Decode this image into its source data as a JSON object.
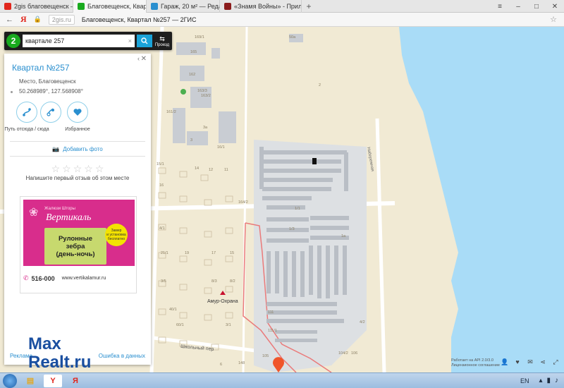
{
  "browser": {
    "tabs": [
      {
        "label": "2gis благовещенск — Янд",
        "favicon": "yandex-icon",
        "color": "#e1261c",
        "active": false
      },
      {
        "label": "Благовещенск, Квартал",
        "favicon": "2gis-icon",
        "color": "#19aa1e",
        "active": true
      },
      {
        "label": "Гараж, 20 м² — Редактир",
        "favicon": "maxrealt-icon",
        "color": "#2a8fcf",
        "active": false
      },
      {
        "label": "«Знамя Войны» - Прилож",
        "favicon": "game-icon",
        "color": "#8b1c1c",
        "active": false
      }
    ],
    "new_tab": "+",
    "site_badge": "2gis.ru",
    "page_title": "Благовещенск, Квартал №257 — 2ГИС",
    "yandex_logo": "Я"
  },
  "search": {
    "logo": "2",
    "query": "квартале 257",
    "clear": "×",
    "route_label": "Проезд"
  },
  "panel": {
    "title": "Квартал №257",
    "place": "Место, Благовещенск",
    "coords": "50.268989°, 127.568908°",
    "actions": [
      {
        "label": "Путь отсюда / сюда",
        "icon": "route-icon"
      },
      {
        "label": "Поделиться",
        "icon": "share-icon"
      },
      {
        "label": "Избранное",
        "icon": "heart-icon"
      }
    ],
    "add_photo": "Добавить фото",
    "review_prompt": "Напишите первый отзыв об этом месте",
    "footer_left": "Реклама",
    "footer_right": "Ошибка в данных"
  },
  "ad": {
    "small_text": "Жалюзи Шторы",
    "brand": "Вертикаль",
    "product_lines": [
      "Рулонные",
      "зебра",
      "(день-ночь)"
    ],
    "badge_lines": [
      "Замер",
      "и установка",
      "бесплатно"
    ],
    "phone": "516-000",
    "site": "www.vertikalamur.ru"
  },
  "map": {
    "labels": {
      "street_naberezhnaya": "Набережная",
      "street_shkolny": "Школьный пер",
      "poi_amur_okhrana": "Амур-Охрана"
    },
    "house_numbers": [
      "169/1",
      "165",
      "162",
      "163/3",
      "163/2",
      "161/2",
      "3а",
      "3",
      "50а",
      "2",
      "16/1",
      "15/1",
      "16",
      "14",
      "12",
      "11",
      "164/2",
      "1/1",
      "1/3",
      "1а",
      "4/1",
      "21/1",
      "19",
      "17",
      "15",
      "3/5",
      "8/3",
      "8/2",
      "111",
      "111/1",
      "40/1",
      "60/1",
      "3/1",
      "4/2",
      "106",
      "104/2",
      "148",
      "105",
      "6"
    ],
    "attribution_lines": [
      "Работает на API 2.0/3.0",
      "Лицензионное соглашение"
    ],
    "tools": [
      "person-icon",
      "heart-icon",
      "chat-icon",
      "share-icon",
      "fullscreen-icon"
    ]
  },
  "watermark": {
    "line1": "Max",
    "line2": "Realt.ru"
  },
  "taskbar": {
    "apps": [
      {
        "name": "explorer",
        "glyph": "▤",
        "color": "#e0a92a"
      },
      {
        "name": "yandex-browser",
        "glyph": "Y",
        "color": "#e1261c"
      },
      {
        "name": "yandex-app",
        "glyph": "Я",
        "color": "#e1261c"
      }
    ],
    "lang": "EN"
  },
  "colors": {
    "land": "#f1ead4",
    "water": "#a9dcf7",
    "blocks": "#c9cdd3",
    "garage_area": "#dde0e3",
    "accent": "#2a8fcf",
    "search_button": "#1aa3d8",
    "boundary": "#ea7a7a"
  }
}
